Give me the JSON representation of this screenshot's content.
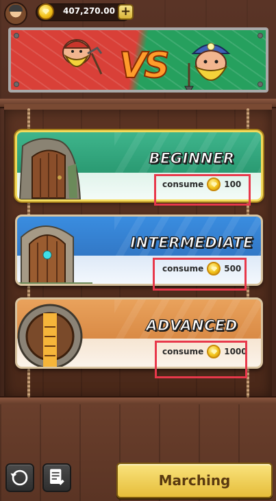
{
  "top_bar": {
    "gem_amount": "407,270.00",
    "add_label": "+"
  },
  "banner": {
    "vs_text": "VS"
  },
  "levels": [
    {
      "title": "BEGINNER",
      "consume_label": "consume",
      "cost": "100",
      "selected": true
    },
    {
      "title": "INTERMEDIATE",
      "consume_label": "consume",
      "cost": "500",
      "selected": false
    },
    {
      "title": "ADVANCED",
      "consume_label": "consume",
      "cost": "1000",
      "selected": false
    }
  ],
  "bottom_bar": {
    "marching_label": "Marching"
  },
  "colors": {
    "highlight_box": "#e8384b",
    "beginner": "#3fb58c",
    "intermediate": "#3a8de0",
    "advanced": "#e9a25c",
    "primary_button": "#f2d25a"
  },
  "icons": {
    "avatar": "miner-avatar",
    "currency": "gem-coin-icon",
    "back": "back-arrow-icon",
    "log": "notepad-icon"
  }
}
